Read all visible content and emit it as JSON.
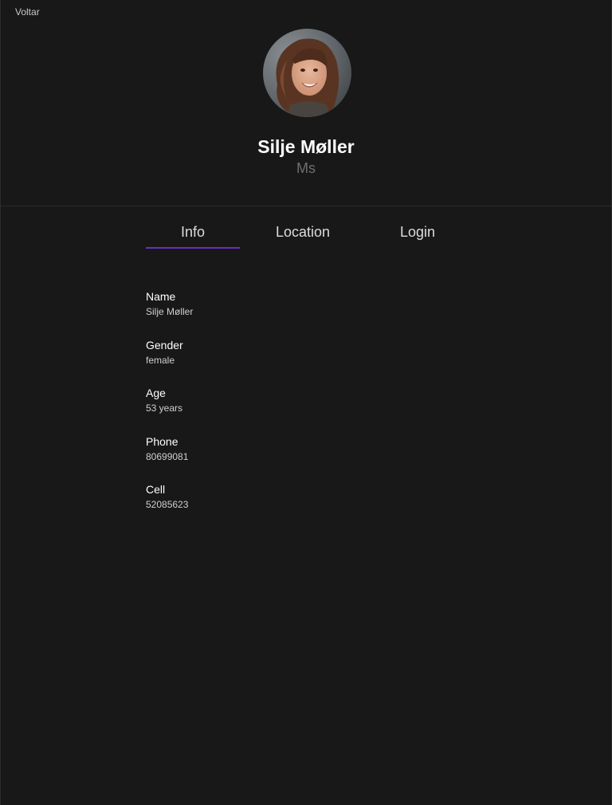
{
  "nav": {
    "back_label": "Voltar"
  },
  "profile": {
    "name": "Silje Møller",
    "title": "Ms"
  },
  "tabs": [
    {
      "label": "Info",
      "active": true
    },
    {
      "label": "Location",
      "active": false
    },
    {
      "label": "Login",
      "active": false
    }
  ],
  "info": [
    {
      "label": "Name",
      "value": "Silje Møller"
    },
    {
      "label": "Gender",
      "value": "female"
    },
    {
      "label": "Age",
      "value": "53 years"
    },
    {
      "label": "Phone",
      "value": "80699081"
    },
    {
      "label": "Cell",
      "value": "52085623"
    }
  ],
  "colors": {
    "background": "#181818",
    "accent": "#6a2fc0",
    "muted_text": "#6e6e6e"
  }
}
